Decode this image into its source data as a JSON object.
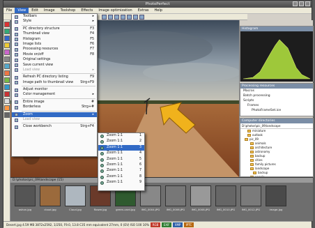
{
  "window": {
    "title": "PhotoPerfect"
  },
  "menubar": [
    "File",
    "View",
    "Edit",
    "Image",
    "Toolshop",
    "Effects",
    "Image optimization",
    "Extras",
    "Help"
  ],
  "view_menu": {
    "items": [
      {
        "label": "Toolbars",
        "shortcut": "",
        "arrow": true
      },
      {
        "label": "Style",
        "shortcut": "",
        "arrow": true
      },
      {
        "sep": true
      },
      {
        "label": "PC directory structure",
        "shortcut": "F3"
      },
      {
        "label": "Thumbnail view",
        "shortcut": "F4"
      },
      {
        "label": "Histogram",
        "shortcut": "F5"
      },
      {
        "label": "Image lists",
        "shortcut": "F6"
      },
      {
        "label": "Processing resources",
        "shortcut": "F7"
      },
      {
        "label": "Movie on/off",
        "shortcut": "F8"
      },
      {
        "label": "Original settings",
        "shortcut": ""
      },
      {
        "label": "Save current view",
        "shortcut": ""
      },
      {
        "label": "Load view",
        "shortcut": "",
        "arrow": true,
        "disabled": true
      },
      {
        "sep": true
      },
      {
        "label": "Refresh PC directory listing",
        "shortcut": "F9"
      },
      {
        "label": "Image path to thumbnail view",
        "shortcut": "Strg+F9"
      },
      {
        "sep": true
      },
      {
        "label": "Adjust monitor",
        "shortcut": ""
      },
      {
        "label": "Color management",
        "shortcut": "",
        "arrow": true
      },
      {
        "sep": true
      },
      {
        "label": "Entire image",
        "shortcut": "#"
      },
      {
        "label": "Borderless",
        "shortcut": "Strg+#"
      },
      {
        "sep": true
      },
      {
        "label": "Zoom",
        "shortcut": "",
        "arrow": true,
        "highlight": true
      },
      {
        "label": "Load view",
        "shortcut": "",
        "disabled": true
      },
      {
        "sep": true
      },
      {
        "label": "Close workbench",
        "shortcut": "Strg+F4"
      }
    ]
  },
  "zoom_menu": {
    "items": [
      {
        "label": "Zoom 1:1",
        "shortcut": "1"
      },
      {
        "label": "Zoom 1:1",
        "shortcut": "2"
      },
      {
        "label": "Zoom 1:1",
        "shortcut": "3",
        "highlight": true
      },
      {
        "label": "Zoom 1:1",
        "shortcut": "4"
      },
      {
        "label": "Zoom 1:1",
        "shortcut": "5"
      },
      {
        "label": "Zoom 1:1",
        "shortcut": "6"
      },
      {
        "label": "Zoom 1:1",
        "shortcut": "7"
      },
      {
        "label": "Zoom 1:1",
        "shortcut": "8"
      },
      {
        "label": "Zoom 1:1",
        "shortcut": "9"
      }
    ]
  },
  "panels": {
    "histogram": "Histogram",
    "processing": "Processing resources",
    "processing_items": [
      "Macros",
      "Batch processing",
      "Scripts",
      "Frames",
      "PhotoFrameSet.ice"
    ],
    "folder": "Computer directories",
    "folder_path": "D:\\photos\\pic_09\\landscape",
    "folder_items": [
      "miniature",
      "outlook",
      "pic_09",
      "animals",
      "architecture",
      "astronomy",
      "backup",
      "cities",
      "family pictures",
      "landscape",
      "backup",
      "people"
    ]
  },
  "thumbstrip": {
    "header": "D:\\photos\\pic_09\\landscape (15)",
    "captions": [
      "ashon.jpg",
      "cloud.jpg",
      "Cloud.jpg",
      "flower.jpg",
      "green-card.jpg",
      "IMG_0004.JPG",
      "IMG_0006.JPG",
      "IMG_0008.JPG",
      "IMG_0010.JPG",
      "IMG_0012.JPG",
      "image.jpg"
    ]
  },
  "status": {
    "text": "Desert.jpg  4.59 MB  3872x2592, 1/250, F9.0, 13.8 C35 mm equivalent 27mm, 0 (EV) ISO 100  10%",
    "badges": [
      "RGB",
      "EXIF",
      "XMP",
      "IPTC"
    ]
  },
  "colors": {
    "accent": "#316ac5",
    "badge_red": "#c0392b",
    "badge_green": "#2f7d32",
    "badge_blue": "#2d5fa8",
    "badge_orange": "#b7670f"
  }
}
